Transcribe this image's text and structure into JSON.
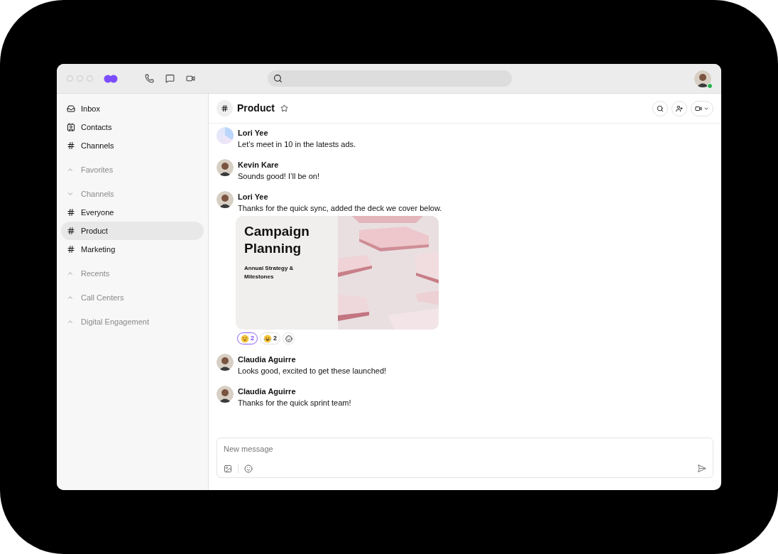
{
  "sidebar": {
    "items": [
      {
        "kind": "link",
        "label": "Inbox",
        "selected": false
      },
      {
        "kind": "link",
        "label": "Contacts",
        "selected": false
      },
      {
        "kind": "link",
        "label": "Channels",
        "selected": false
      },
      {
        "kind": "section",
        "label": "Favorites",
        "expanded": false
      },
      {
        "kind": "section",
        "label": "Channels",
        "expanded": true
      },
      {
        "kind": "link",
        "label": "Everyone",
        "selected": false
      },
      {
        "kind": "link",
        "label": "Product",
        "selected": true
      },
      {
        "kind": "link",
        "label": "Marketing",
        "selected": false
      },
      {
        "kind": "section",
        "label": "Recents",
        "expanded": false
      },
      {
        "kind": "section",
        "label": "Call Centers",
        "expanded": false
      },
      {
        "kind": "section",
        "label": "Digital Engagement",
        "expanded": false
      }
    ]
  },
  "channel": {
    "title": "Product",
    "starred": false
  },
  "messages": [
    {
      "author": "Lori Yee",
      "text": "Let’s meet in 10 in the latests ads."
    },
    {
      "author": "Kevin Kare",
      "text": "Sounds good! I’ll be on!"
    },
    {
      "author": "Lori Yee",
      "text": "Thanks for the quick sync, added the deck we cover below.",
      "attachment": {
        "title": "Campaign Planning",
        "subtitle": "Annual Strategy & Milestones"
      },
      "reactions": [
        {
          "count": "2",
          "selected": true
        },
        {
          "count": "2",
          "selected": false
        }
      ]
    },
    {
      "author": "Claudia Aguirre",
      "text": "Looks good, excited to get these launched!"
    },
    {
      "author": "Claudia Aguirre",
      "text": "Thanks for the quick sprint team!"
    }
  ],
  "composer": {
    "placeholder": "New message"
  }
}
